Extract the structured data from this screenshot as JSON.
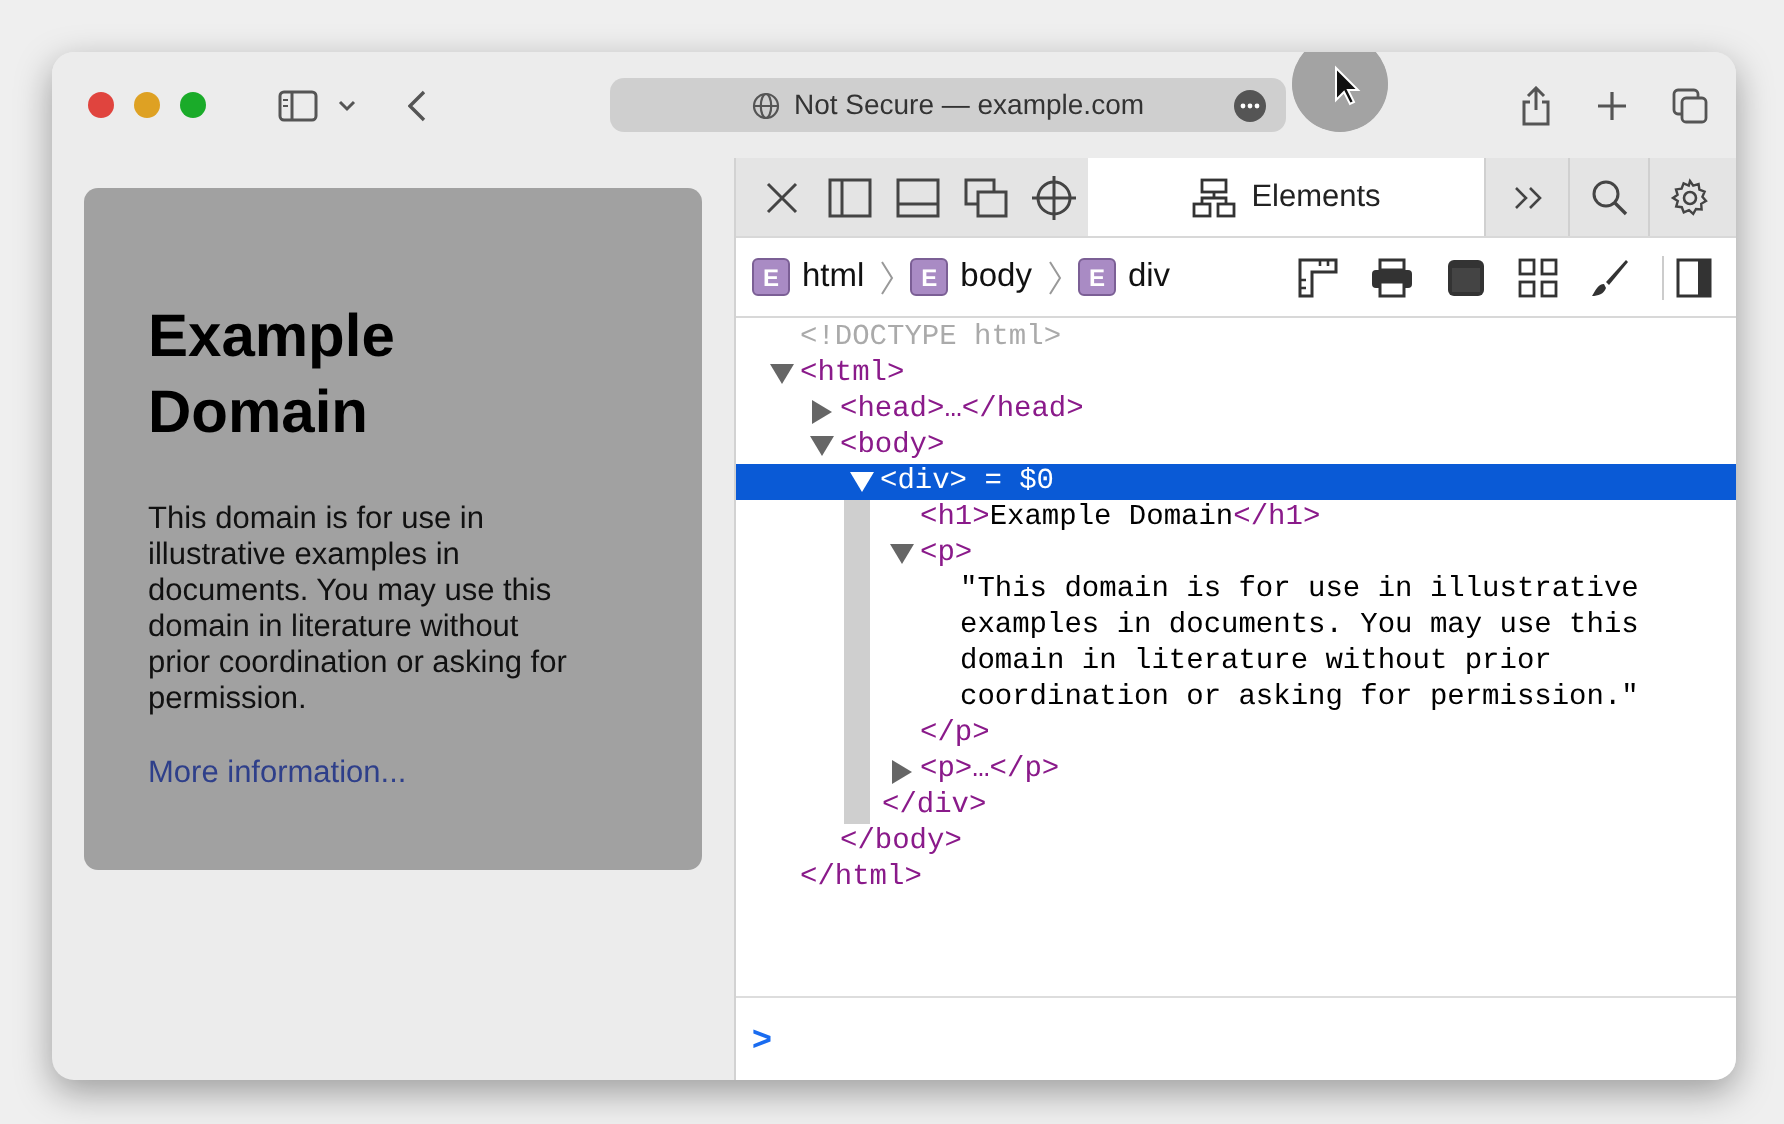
{
  "toolbar": {
    "address": "Not Secure — example.com"
  },
  "page": {
    "heading": "Example Domain",
    "paragraph": "This domain is for use in illustrative examples in documents. You may use this domain in literature without prior coordination or asking for permission.",
    "link": "More information..."
  },
  "devtools": {
    "tabs": [
      {
        "label": "Elements",
        "selected": true
      }
    ],
    "breadcrumbs": [
      {
        "badge": "E",
        "label": "html"
      },
      {
        "badge": "E",
        "label": "body"
      },
      {
        "badge": "E",
        "label": "div"
      }
    ],
    "dom": [
      {
        "kind": "doctype",
        "text": "<!DOCTYPE html>"
      },
      {
        "kind": "element",
        "text": "<html>",
        "expanded": true,
        "selected": false,
        "closing": "</html>",
        "children": [
          {
            "kind": "element",
            "text": "<head>…</head>",
            "expanded": false,
            "selected": false
          },
          {
            "kind": "element",
            "text": "<body>",
            "expanded": true,
            "selected": false,
            "closing": "</body>",
            "children": [
              {
                "kind": "element",
                "text": "<div>",
                "note": "= $0",
                "expanded": true,
                "selected": true,
                "closing": "</div>",
                "children": [
                  {
                    "kind": "inline",
                    "open": "<h1>",
                    "content": "Example Domain",
                    "close": "</h1>"
                  },
                  {
                    "kind": "element",
                    "text": "<p>",
                    "expanded": true,
                    "selected": false,
                    "closing": "</p>",
                    "children": [
                      {
                        "kind": "text",
                        "text": "\"This domain is for use in illustrative examples in documents. You may use this domain in literature without prior coordination or asking for permission.\""
                      }
                    ]
                  },
                  {
                    "kind": "element",
                    "text": "<p>…</p>",
                    "expanded": false,
                    "selected": false
                  }
                ]
              }
            ]
          }
        ]
      }
    ],
    "console": {
      "prompt": ">"
    }
  }
}
